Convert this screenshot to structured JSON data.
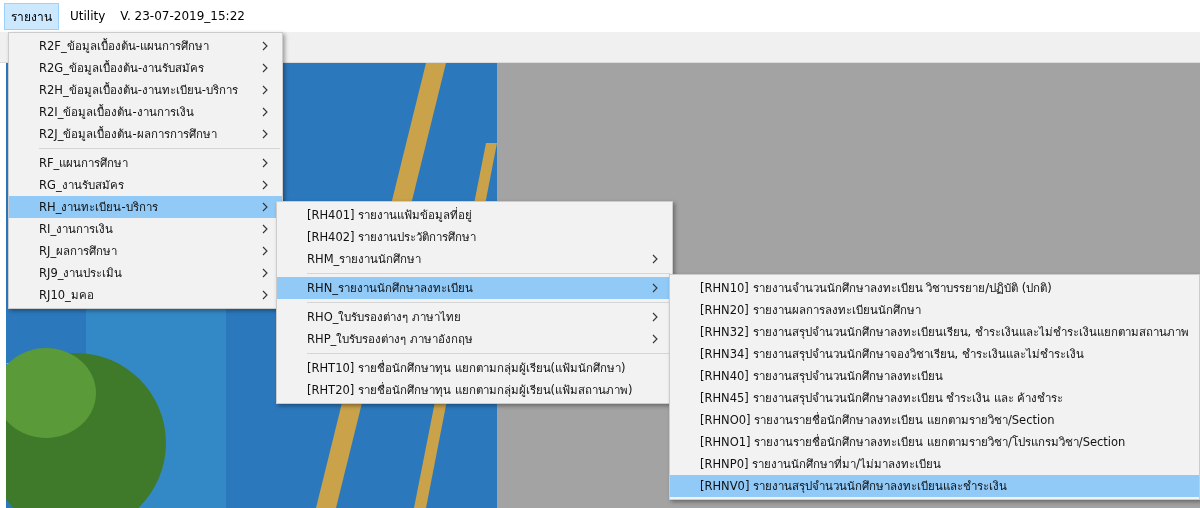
{
  "menubar": {
    "items": [
      {
        "label": "รายงาน",
        "selected": true
      },
      {
        "label": "Utility",
        "selected": false
      }
    ],
    "version": "V. 23-07-2019_15:22"
  },
  "menus": [
    {
      "groups": [
        {
          "items": [
            {
              "label": "R2F_ข้อมูลเบื้องต้น-แผนการศึกษา",
              "submenu": true,
              "selected": false
            },
            {
              "label": "R2G_ข้อมูลเบื้องต้น-งานรับสมัคร",
              "submenu": true,
              "selected": false
            },
            {
              "label": "R2H_ข้อมูลเบื้องต้น-งานทะเบียน-บริการ",
              "submenu": true,
              "selected": false
            },
            {
              "label": "R2I_ข้อมูลเบื้องต้น-งานการเงิน",
              "submenu": true,
              "selected": false
            },
            {
              "label": "R2J_ข้อมูลเบื้องต้น-ผลการการศึกษา",
              "submenu": true,
              "selected": false
            }
          ]
        },
        {
          "items": [
            {
              "label": "RF_แผนการศึกษา",
              "submenu": true,
              "selected": false
            },
            {
              "label": "RG_งานรับสมัคร",
              "submenu": true,
              "selected": false
            },
            {
              "label": "RH_งานทะเบียน-บริการ",
              "submenu": true,
              "selected": true
            },
            {
              "label": "RI_งานการเงิน",
              "submenu": true,
              "selected": false
            },
            {
              "label": "RJ_ผลการศึกษา",
              "submenu": true,
              "selected": false
            },
            {
              "label": "RJ9_งานประเมิน",
              "submenu": true,
              "selected": false
            },
            {
              "label": "RJ10_มคอ",
              "submenu": true,
              "selected": false
            }
          ]
        }
      ]
    },
    {
      "groups": [
        {
          "items": [
            {
              "label": "[RH401] รายงานแฟ้มข้อมูลที่อยู่",
              "submenu": false,
              "selected": false
            },
            {
              "label": "[RH402] รายงานประวัติการศึกษา",
              "submenu": false,
              "selected": false
            },
            {
              "label": "RHM_รายงานนักศึกษา",
              "submenu": true,
              "selected": false
            }
          ]
        },
        {
          "items": [
            {
              "label": "RHN_รายงานนักศึกษาลงทะเบียน",
              "submenu": true,
              "selected": true
            }
          ]
        },
        {
          "items": [
            {
              "label": "RHO_ใบรับรองต่างๆ ภาษาไทย",
              "submenu": true,
              "selected": false
            },
            {
              "label": "RHP_ใบรับรองต่างๆ ภาษาอังกฤษ",
              "submenu": true,
              "selected": false
            }
          ]
        },
        {
          "items": [
            {
              "label": "[RHT10] รายชื่อนักศึกษาทุน แยกตามกลุ่มผู้เรียน(แฟ้มนักศึกษา)",
              "submenu": false,
              "selected": false
            },
            {
              "label": "[RHT20] รายชื่อนักศึกษาทุน แยกตามกลุ่มผู้เรียน(แฟ้มสถานภาพ)",
              "submenu": false,
              "selected": false
            }
          ]
        }
      ]
    },
    {
      "groups": [
        {
          "items": [
            {
              "label": "[RHN10] รายงานจำนวนนักศึกษาลงทะเบียน วิชาบรรยาย/ปฏิบัติ (ปกติ)",
              "submenu": false,
              "selected": false
            },
            {
              "label": "[RHN20] รายงานผลการลงทะเบียนนักศึกษา",
              "submenu": false,
              "selected": false
            },
            {
              "label": "[RHN32] รายงานสรุปจำนวนนักศึกษาลงทะเบียนเรียน, ชำระเงินและไม่ชำระเงินแยกตามสถานภาพ",
              "submenu": false,
              "selected": false
            },
            {
              "label": "[RHN34] รายงานสรุปจำนวนนักศึกษาจองวิชาเรียน, ชำระเงินและไม่ชำระเงิน",
              "submenu": false,
              "selected": false
            },
            {
              "label": "[RHN40] รายงานสรุปจำนวนนักศึกษาลงทะเบียน",
              "submenu": false,
              "selected": false
            },
            {
              "label": "[RHN45] รายงานสรุปจำนวนนักศึกษาลงทะเบียน ชำระเงิน และ ค้างชำระ",
              "submenu": false,
              "selected": false
            },
            {
              "label": "[RHNO0] รายงานรายชื่อนักศึกษาลงทะเบียน แยกตามรายวิชา/Section",
              "submenu": false,
              "selected": false
            },
            {
              "label": "[RHNO1] รายงานรายชื่อนักศึกษาลงทะเบียน แยกตามรายวิชา/โปรแกรมวิชา/Section",
              "submenu": false,
              "selected": false
            },
            {
              "label": "[RHNP0] รายงานนักศึกษาที่มา/ไม่มาลงทะเบียน",
              "submenu": false,
              "selected": false
            },
            {
              "label": "[RHNV0] รายงานสรุปจำนวนนักศึกษาลงทะเบียนและชำระเงิน",
              "submenu": false,
              "selected": true
            }
          ]
        }
      ]
    }
  ]
}
